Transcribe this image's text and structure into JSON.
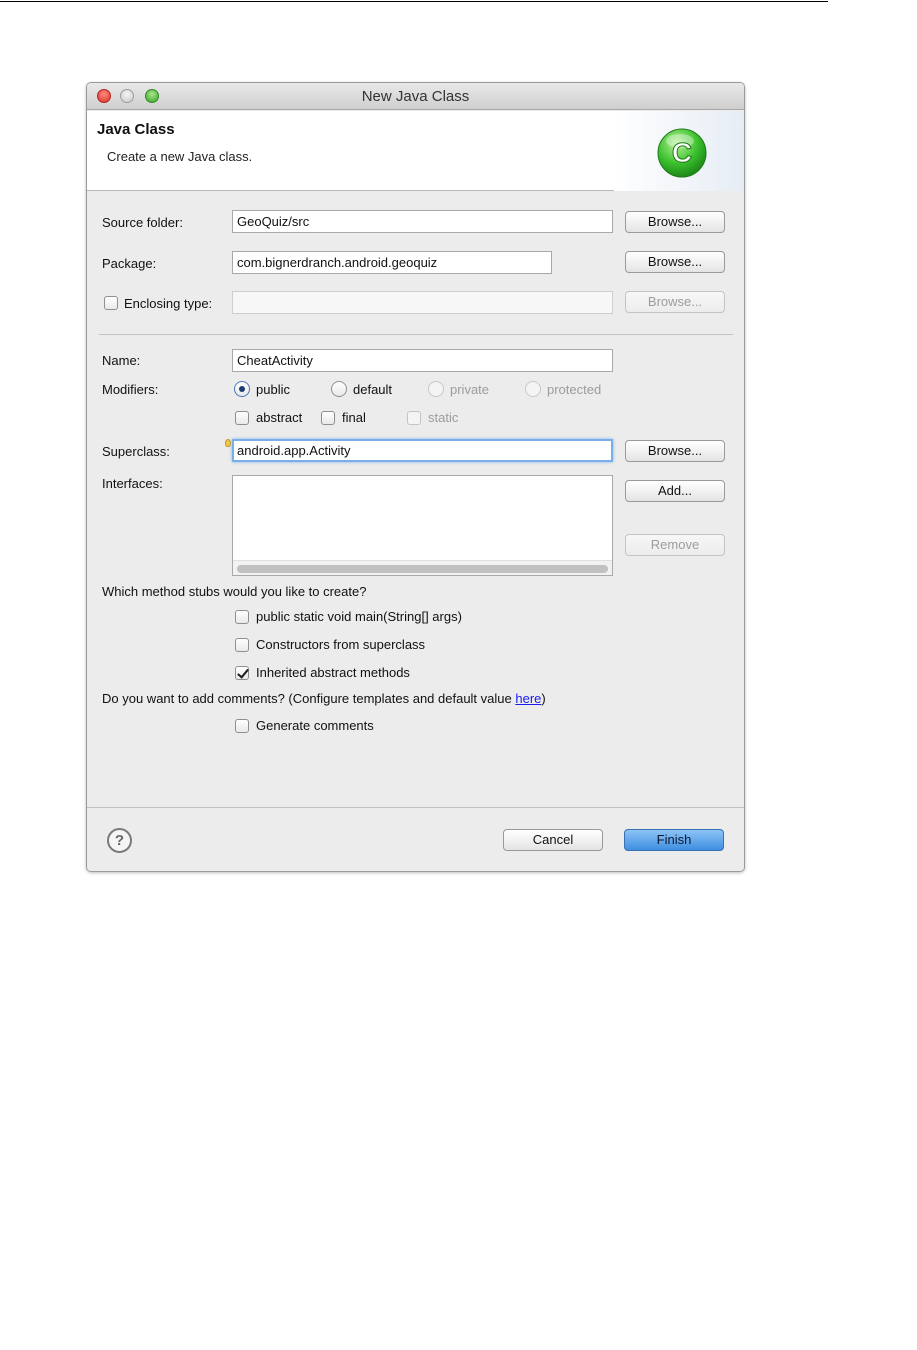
{
  "window": {
    "title": "New Java Class"
  },
  "banner": {
    "title": "Java Class",
    "subtitle": "Create a new Java class.",
    "icon": "java-class-c-icon",
    "icon_letter": "C",
    "icon_color": "#3cc12e"
  },
  "fields": {
    "source_folder": {
      "label": "Source folder:",
      "value": "GeoQuiz/src",
      "button": "Browse..."
    },
    "package": {
      "label": "Package:",
      "value": "com.bignerdranch.android.geoquiz",
      "button": "Browse..."
    },
    "enclosing_type": {
      "label": "Enclosing type:",
      "value": "",
      "checked": false,
      "button": "Browse..."
    },
    "name": {
      "label": "Name:",
      "value": "CheatActivity"
    },
    "superclass": {
      "label": "Superclass:",
      "value": "android.app.Activity",
      "button": "Browse..."
    },
    "interfaces": {
      "label": "Interfaces:",
      "add_button": "Add...",
      "remove_button": "Remove"
    }
  },
  "modifiers": {
    "label": "Modifiers:",
    "access": [
      {
        "label": "public",
        "selected": true,
        "enabled": true
      },
      {
        "label": "default",
        "selected": false,
        "enabled": true
      },
      {
        "label": "private",
        "selected": false,
        "enabled": false
      },
      {
        "label": "protected",
        "selected": false,
        "enabled": false
      }
    ],
    "flags": [
      {
        "label": "abstract",
        "checked": false,
        "enabled": true
      },
      {
        "label": "final",
        "checked": false,
        "enabled": true
      },
      {
        "label": "static",
        "checked": false,
        "enabled": false
      }
    ]
  },
  "stubs": {
    "question": "Which method stubs would you like to create?",
    "options": [
      {
        "label": "public static void main(String[] args)",
        "checked": false
      },
      {
        "label": "Constructors from superclass",
        "checked": false
      },
      {
        "label": "Inherited abstract methods",
        "checked": true
      }
    ]
  },
  "comments": {
    "question_prefix": "Do you want to add comments? (Configure templates and default value ",
    "link": "here",
    "question_suffix": ")",
    "option": {
      "label": "Generate comments",
      "checked": false
    }
  },
  "footer": {
    "help": "?",
    "cancel": "Cancel",
    "finish": "Finish",
    "accent_color": "#3d8fe0"
  }
}
